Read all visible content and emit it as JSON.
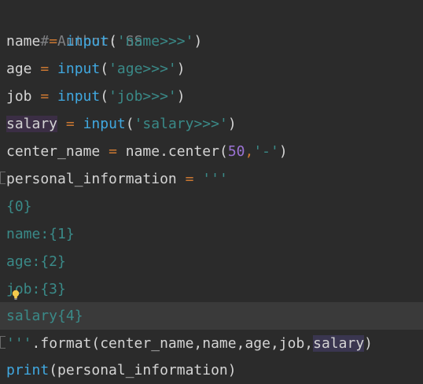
{
  "code": {
    "comment_text": "# Author: SS",
    "l1": {
      "var": "name",
      "eq": "=",
      "fn": "input",
      "open": "(",
      "str": "'name>>>'",
      "close": ")"
    },
    "l2": {
      "var": "age",
      "eq": "=",
      "fn": "input",
      "open": "(",
      "str": "'age>>>'",
      "close": ")"
    },
    "l3": {
      "var": "job",
      "eq": "=",
      "fn": "input",
      "open": "(",
      "str": "'job>>>'",
      "close": ")"
    },
    "l4": {
      "var": "salary",
      "eq": "=",
      "fn": "input",
      "open": "(",
      "str": "'salary>>>'",
      "close": ")"
    },
    "l5": {
      "var": "center_name",
      "eq": "=",
      "obj": "name.center",
      "open": "(",
      "num": "50",
      "comma": ",",
      "str": "'-'",
      "close": ")"
    },
    "l6": {
      "var": "personal_information",
      "eq": "=",
      "str": "'''"
    },
    "l7": "{0}",
    "l8": "name:{1}",
    "l9": "age:{2}",
    "l10": "job:{3}",
    "l11": "salary{4}",
    "l12": {
      "str": "'''",
      "method": ".format(center_name,name,age,job,",
      "hl_arg": "salary",
      "close": ")"
    },
    "l13": "print(personal_information)"
  },
  "colors": {
    "background": "#2b2b2b",
    "current_line": "#3a3a3a",
    "comment": "#7f8083",
    "operator": "#cc7832",
    "builtin_fn": "#40a8e0",
    "string": "#3a8a88",
    "number": "#9b73d4",
    "identifier": "#d4d4d4"
  },
  "icons": {
    "intention_bulb": "lightbulb-icon",
    "fold_marker": "fold-marker-icon"
  }
}
